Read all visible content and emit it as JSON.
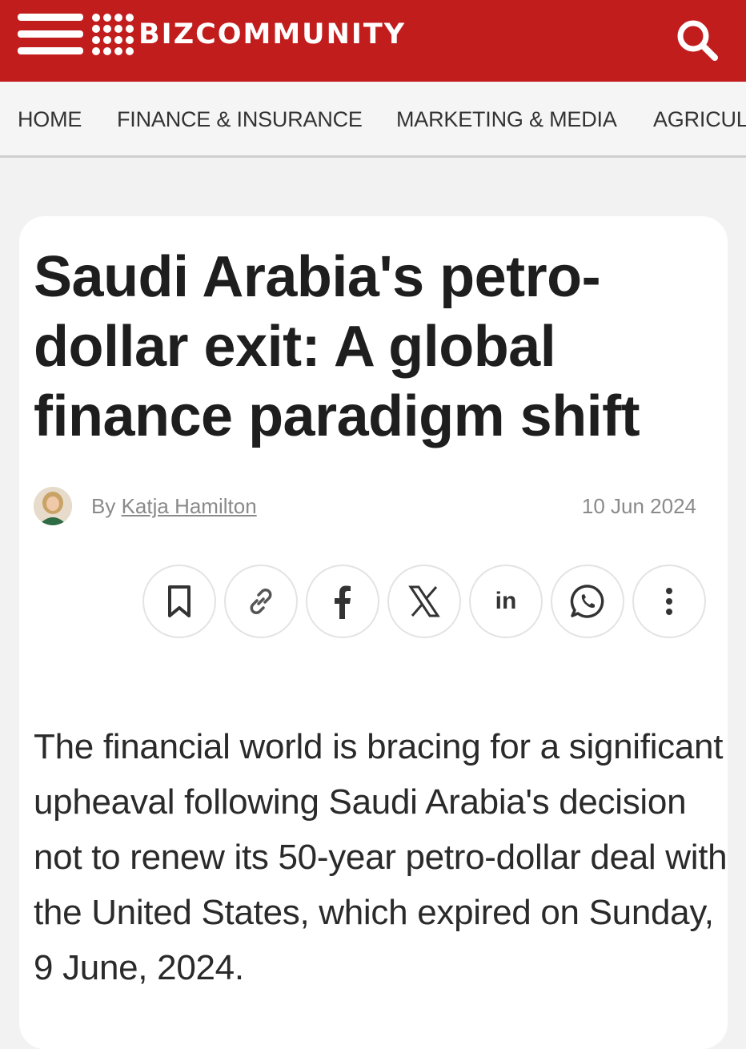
{
  "brand": {
    "name": "bizcommunity",
    "color": "#c21d1d"
  },
  "nav": {
    "items": [
      "HOME",
      "FINANCE & INSURANCE",
      "MARKETING & MEDIA",
      "AGRICUL"
    ]
  },
  "article": {
    "title": "Saudi Arabia's petro-dollar exit: A global finance paradigm shift",
    "byline_prefix": "By",
    "author": "Katja Hamilton",
    "date": "10 Jun 2024",
    "intro": "The financial world is bracing for a significant upheaval following Saudi Arabia's decision not to renew its 50-year petro-dollar deal with the United States, which expired on Sunday, 9 June, 2024."
  },
  "share": {
    "buttons": [
      "bookmark-icon",
      "link-icon",
      "facebook-icon",
      "x-icon",
      "linkedin-icon",
      "whatsapp-icon",
      "more-icon"
    ]
  },
  "icons": {
    "menu": "hamburger-icon",
    "search": "search-icon",
    "logo": "logo-mark-icon"
  }
}
